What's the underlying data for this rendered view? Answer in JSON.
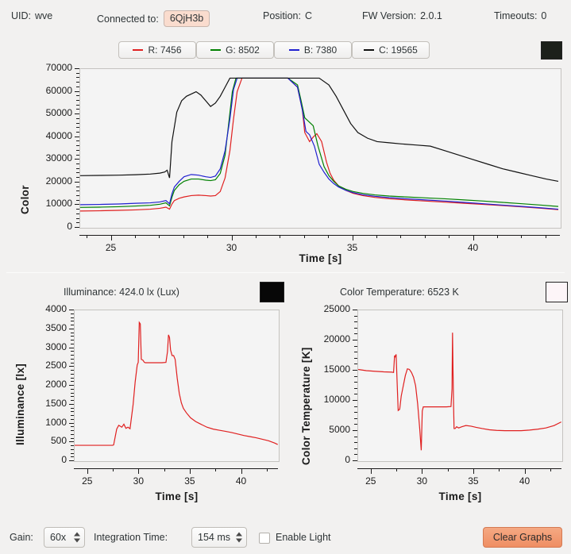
{
  "status": {
    "uid_label": "UID:",
    "uid_value": "wve",
    "connected_label": "Connected to:",
    "connected_value": "6QjH3b",
    "position_label": "Position:",
    "position_value": "C",
    "fw_label": "FW Version:",
    "fw_value": "2.0.1",
    "timeouts_label": "Timeouts:",
    "timeouts_value": "0"
  },
  "legend": [
    {
      "label": "R: 7456",
      "color": "#e02020",
      "name": "legend-red"
    },
    {
      "label": "G: 8502",
      "color": "#008000",
      "name": "legend-green"
    },
    {
      "label": "B: 7380",
      "color": "#2020d0",
      "name": "legend-blue"
    },
    {
      "label": "C: 19565",
      "color": "#101010",
      "name": "legend-clear"
    }
  ],
  "color_swatch": {
    "hex": "#1c201a",
    "name": "color-preview-swatch"
  },
  "illuminance": {
    "title": "Illuminance: 424.0 lx (Lux)",
    "swatch": "#070707"
  },
  "color_temperature": {
    "title": "Color Temperature: 6523 K",
    "swatch": "#fdf5f8"
  },
  "toolbar": {
    "gain_label": "Gain:",
    "gain_value": "60x",
    "integration_label": "Integration Time:",
    "integration_value": "154 ms",
    "enable_light_label": "Enable Light",
    "enable_light_checked": false,
    "clear_label": "Clear Graphs"
  },
  "chart_data": [
    {
      "id": "color",
      "type": "line",
      "title": "",
      "xlabel": "Time [s]",
      "ylabel": "Color",
      "xlim": [
        23.7,
        43.6
      ],
      "ylim": [
        0,
        70000
      ],
      "xticks": [
        25,
        30,
        35,
        40
      ],
      "yticks": [
        0,
        10000,
        20000,
        30000,
        40000,
        50000,
        60000,
        70000
      ],
      "grid": false,
      "legend_position": "top",
      "series": [
        {
          "name": "R",
          "color": "#e02020",
          "x": [
            23.7,
            24.5,
            25.3,
            26.0,
            26.6,
            27.0,
            27.25,
            27.4,
            27.5,
            27.6,
            27.8,
            28.0,
            28.3,
            28.6,
            28.9,
            29.1,
            29.3,
            29.5,
            29.7,
            29.9,
            30.05,
            30.2,
            30.4,
            30.8,
            31.5,
            32.3,
            32.7,
            32.9,
            33.0,
            33.2,
            33.35,
            33.5,
            33.7,
            33.9,
            34.05,
            34.2,
            34.4,
            34.7,
            35.0,
            35.4,
            35.9,
            36.5,
            37.2,
            38.0,
            38.8,
            39.6,
            40.4,
            41.2,
            42.0,
            42.8,
            43.5
          ],
          "y": [
            7400,
            7500,
            7700,
            7900,
            8200,
            8600,
            9100,
            8200,
            10500,
            12000,
            13000,
            13600,
            14200,
            14400,
            14200,
            14000,
            14200,
            16000,
            22000,
            34000,
            48000,
            60000,
            66000,
            66000,
            66000,
            66000,
            62000,
            52000,
            42000,
            38000,
            40000,
            41500,
            38000,
            29000,
            24000,
            21000,
            18500,
            16500,
            15200,
            14200,
            13400,
            12800,
            12300,
            11800,
            11300,
            10800,
            10300,
            9800,
            9200,
            8600,
            8000
          ]
        },
        {
          "name": "G",
          "color": "#008000",
          "x": [
            23.7,
            24.5,
            25.3,
            26.0,
            26.6,
            27.0,
            27.25,
            27.4,
            27.5,
            27.6,
            27.8,
            28.0,
            28.3,
            28.6,
            28.9,
            29.1,
            29.3,
            29.5,
            29.7,
            29.85,
            30.0,
            30.15,
            30.4,
            30.8,
            31.5,
            32.3,
            32.7,
            32.85,
            33.0,
            33.15,
            33.35,
            33.55,
            33.8,
            34.0,
            34.2,
            34.4,
            34.7,
            35.0,
            35.4,
            35.9,
            36.5,
            37.2,
            38.0,
            38.8,
            39.6,
            40.4,
            41.2,
            42.0,
            42.8,
            43.5
          ],
          "y": [
            9000,
            9100,
            9300,
            9600,
            9900,
            10400,
            11000,
            9700,
            13500,
            16500,
            19000,
            20500,
            21500,
            21500,
            21000,
            20800,
            21200,
            24000,
            32000,
            46000,
            60000,
            66000,
            66000,
            66000,
            66000,
            66000,
            63000,
            56000,
            48500,
            47000,
            45000,
            36000,
            27000,
            23000,
            20500,
            18500,
            17000,
            16000,
            15200,
            14500,
            14000,
            13600,
            13200,
            12800,
            12300,
            11800,
            11200,
            10600,
            10000,
            9400
          ]
        },
        {
          "name": "B",
          "color": "#2020d0",
          "x": [
            23.7,
            24.5,
            25.3,
            26.0,
            26.6,
            27.0,
            27.25,
            27.4,
            27.5,
            27.6,
            27.8,
            28.0,
            28.3,
            28.6,
            28.9,
            29.1,
            29.3,
            29.5,
            29.7,
            29.9,
            30.05,
            30.2,
            30.4,
            30.8,
            31.5,
            32.3,
            32.7,
            32.9,
            33.05,
            33.2,
            33.4,
            33.6,
            33.8,
            34.0,
            34.2,
            34.4,
            34.7,
            35.0,
            35.4,
            35.9,
            36.5,
            37.2,
            38.0,
            38.8,
            39.6,
            40.4,
            41.2,
            42.0,
            42.8,
            43.5
          ],
          "y": [
            10200,
            10300,
            10500,
            10800,
            11000,
            11400,
            12000,
            10600,
            15000,
            18000,
            20500,
            22500,
            23500,
            23200,
            22500,
            22200,
            22800,
            26000,
            34000,
            48000,
            61000,
            66000,
            66000,
            66000,
            66000,
            66000,
            62000,
            52000,
            42500,
            41000,
            36000,
            28000,
            24500,
            21500,
            19500,
            18000,
            16500,
            15500,
            14600,
            13900,
            13300,
            12800,
            12300,
            11800,
            11200,
            10600,
            10000,
            9400,
            8800,
            8200
          ]
        },
        {
          "name": "C",
          "color": "#101010",
          "x": [
            23.7,
            24.5,
            25.3,
            26.0,
            26.6,
            27.0,
            27.2,
            27.3,
            27.4,
            27.5,
            27.7,
            27.9,
            28.1,
            28.3,
            28.5,
            28.7,
            28.9,
            29.1,
            29.3,
            29.5,
            29.7,
            29.9,
            30.1,
            30.5,
            31.5,
            32.5,
            33.6,
            34.0,
            34.3,
            34.6,
            34.9,
            35.2,
            35.6,
            36.0,
            36.5,
            37.0,
            37.6,
            38.2,
            38.8,
            39.4,
            40.0,
            40.6,
            41.2,
            41.8,
            42.4,
            43.0,
            43.5
          ],
          "y": [
            23000,
            23100,
            23200,
            23400,
            23700,
            24100,
            24600,
            25400,
            22000,
            38000,
            51000,
            56000,
            58000,
            59000,
            60000,
            58500,
            56000,
            53500,
            55000,
            58000,
            62000,
            66000,
            66000,
            66000,
            66000,
            66000,
            66000,
            63000,
            58000,
            52000,
            46000,
            42000,
            39500,
            38000,
            37500,
            37000,
            36500,
            36000,
            34000,
            32000,
            30000,
            28000,
            26000,
            24500,
            23000,
            21500,
            20500
          ]
        }
      ]
    },
    {
      "id": "illuminance",
      "type": "line",
      "title": "Illuminance: 424.0 lx (Lux)",
      "xlabel": "Time [s]",
      "ylabel": "Illuminance [lx]",
      "xlim": [
        23.7,
        43.6
      ],
      "ylim": [
        0,
        4000
      ],
      "xticks": [
        25,
        30,
        35,
        40
      ],
      "yticks": [
        0,
        500,
        1000,
        1500,
        2000,
        2500,
        3000,
        3500,
        4000
      ],
      "grid": false,
      "series": [
        {
          "name": "Illuminance",
          "color": "#e02020",
          "x": [
            23.7,
            25.0,
            26.0,
            27.0,
            27.4,
            27.5,
            27.8,
            28.0,
            28.3,
            28.5,
            28.7,
            28.9,
            29.1,
            29.4,
            29.6,
            29.8,
            29.9,
            30.0,
            30.1,
            30.2,
            30.35,
            30.5,
            30.6,
            31.0,
            31.6,
            32.2,
            32.6,
            32.75,
            32.85,
            32.95,
            33.05,
            33.2,
            33.35,
            33.5,
            33.7,
            33.9,
            34.1,
            34.3,
            34.6,
            35.0,
            35.5,
            36.0,
            36.6,
            37.2,
            37.8,
            38.4,
            39.0,
            39.6,
            40.2,
            40.8,
            41.4,
            42.0,
            42.6,
            43.2,
            43.5
          ],
          "y": [
            420,
            420,
            420,
            420,
            420,
            430,
            850,
            950,
            900,
            980,
            870,
            900,
            860,
            1500,
            2100,
            2550,
            2620,
            3680,
            3640,
            2700,
            2680,
            2620,
            2610,
            2610,
            2610,
            2610,
            2620,
            2900,
            3350,
            3280,
            2950,
            2800,
            2800,
            2700,
            2200,
            1800,
            1550,
            1400,
            1280,
            1150,
            1050,
            980,
            900,
            850,
            820,
            790,
            760,
            720,
            680,
            650,
            620,
            580,
            540,
            480,
            440
          ]
        }
      ]
    },
    {
      "id": "color_temperature",
      "type": "line",
      "title": "Color Temperature: 6523 K",
      "xlabel": "Time [s]",
      "ylabel": "Color Temperature [K]",
      "xlim": [
        23.7,
        43.6
      ],
      "ylim": [
        0,
        25000
      ],
      "xticks": [
        25,
        30,
        35,
        40
      ],
      "yticks": [
        0,
        5000,
        10000,
        15000,
        20000,
        25000
      ],
      "grid": false,
      "series": [
        {
          "name": "Color Temperature",
          "color": "#e02020",
          "x": [
            23.7,
            24.5,
            25.3,
            26.2,
            27.0,
            27.15,
            27.25,
            27.3,
            27.4,
            27.5,
            27.6,
            27.75,
            27.9,
            28.1,
            28.3,
            28.5,
            28.7,
            28.9,
            29.1,
            29.3,
            29.5,
            29.7,
            29.85,
            29.95,
            30.05,
            30.2,
            30.4,
            30.8,
            31.5,
            32.3,
            32.75,
            32.85,
            32.9,
            32.95,
            33.0,
            33.05,
            33.15,
            33.3,
            33.5,
            33.8,
            34.2,
            34.7,
            35.2,
            35.8,
            36.5,
            37.2,
            38.0,
            38.8,
            39.6,
            40.4,
            41.2,
            42.0,
            42.8,
            43.5
          ],
          "y": [
            15200,
            15000,
            14900,
            14800,
            14750,
            14700,
            17500,
            17300,
            17700,
            13000,
            8400,
            8600,
            10800,
            12500,
            14200,
            15300,
            15200,
            14700,
            13900,
            12500,
            9500,
            5400,
            1800,
            8300,
            9000,
            9000,
            9000,
            9000,
            9000,
            9000,
            9050,
            12000,
            21300,
            15000,
            9500,
            5400,
            5400,
            5700,
            5500,
            5700,
            5900,
            5800,
            5600,
            5400,
            5200,
            5100,
            5050,
            5050,
            5050,
            5150,
            5300,
            5500,
            5900,
            6500
          ]
        }
      ]
    }
  ]
}
